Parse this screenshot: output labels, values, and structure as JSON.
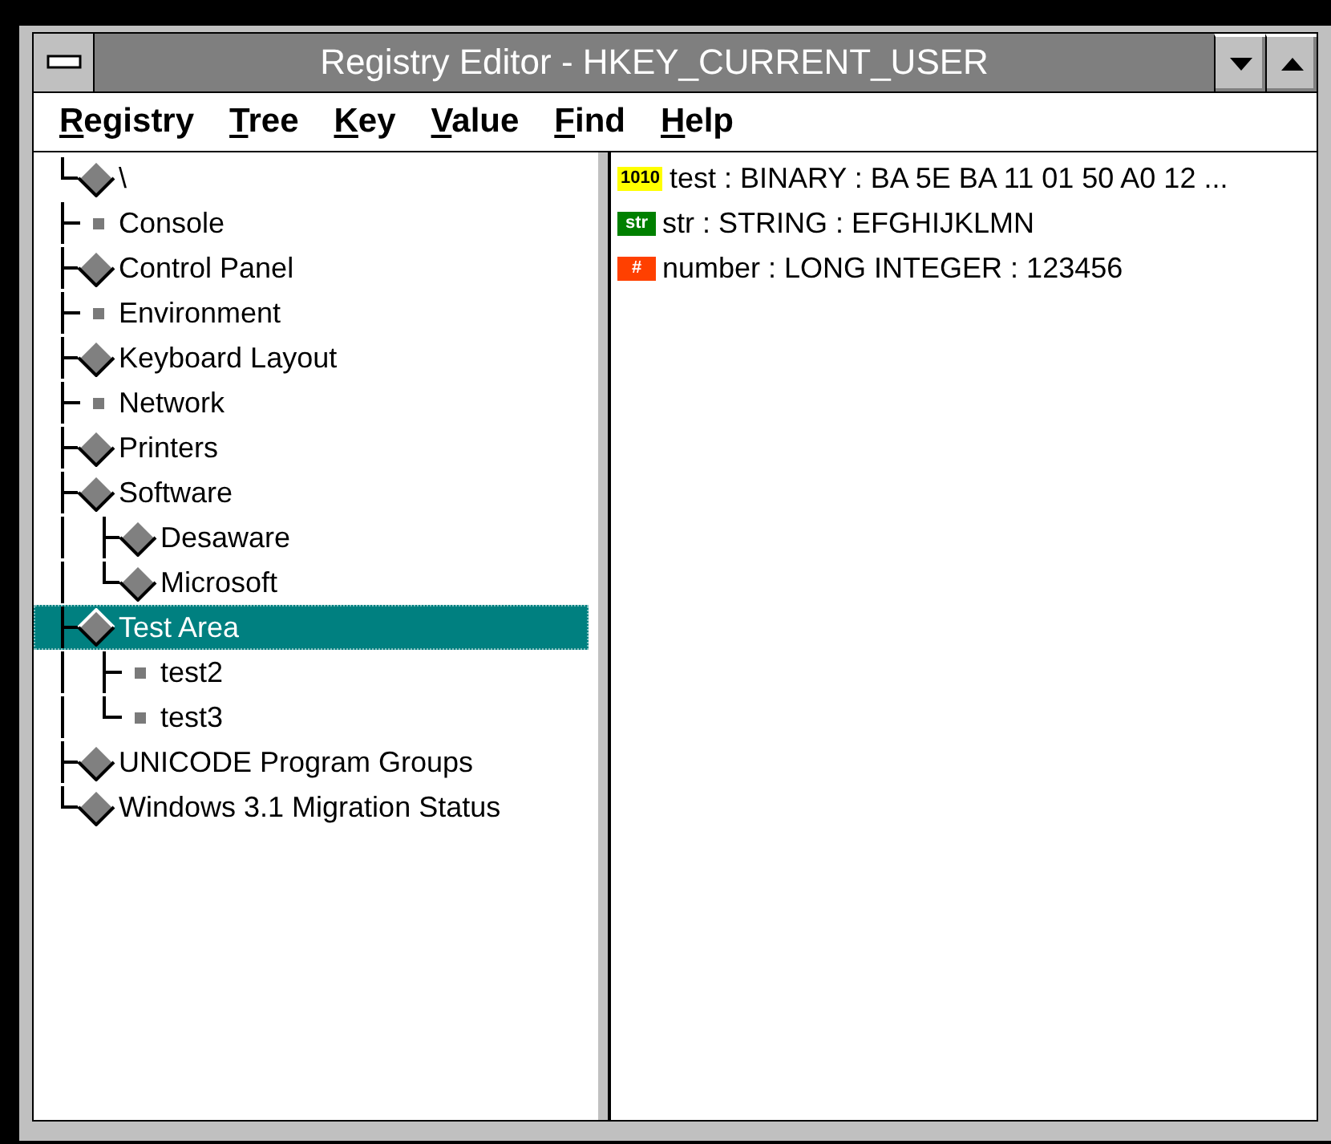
{
  "window": {
    "title": "Registry Editor - HKEY_CURRENT_USER"
  },
  "menu": [
    "Registry",
    "Tree",
    "Key",
    "Value",
    "Find",
    "Help"
  ],
  "tree": {
    "label": "\\",
    "kind": "folder",
    "selected": false,
    "children": [
      {
        "label": "Console",
        "kind": "leaf",
        "selected": false
      },
      {
        "label": "Control Panel",
        "kind": "folder",
        "selected": false
      },
      {
        "label": "Environment",
        "kind": "leaf",
        "selected": false
      },
      {
        "label": "Keyboard Layout",
        "kind": "folder",
        "selected": false
      },
      {
        "label": "Network",
        "kind": "leaf",
        "selected": false
      },
      {
        "label": "Printers",
        "kind": "folder",
        "selected": false
      },
      {
        "label": "Software",
        "kind": "folder",
        "selected": false,
        "children": [
          {
            "label": "Desaware",
            "kind": "folder",
            "selected": false
          },
          {
            "label": "Microsoft",
            "kind": "folder",
            "selected": false
          }
        ]
      },
      {
        "label": "Test Area",
        "kind": "folder",
        "selected": true,
        "children": [
          {
            "label": "test2",
            "kind": "leaf",
            "selected": false
          },
          {
            "label": "test3",
            "kind": "leaf",
            "selected": false
          }
        ]
      },
      {
        "label": "UNICODE Program Groups",
        "kind": "folder",
        "selected": false
      },
      {
        "label": "Windows 3.1 Migration Status",
        "kind": "folder",
        "selected": false
      }
    ]
  },
  "values": [
    {
      "kind": "binary",
      "badge": "1010",
      "text": "test : BINARY : BA 5E BA 11 01 50 A0 12 ..."
    },
    {
      "kind": "string",
      "badge": "str",
      "text": "str : STRING : EFGHIJKLMN"
    },
    {
      "kind": "long",
      "badge": "#",
      "text": "number : LONG INTEGER : 123456"
    }
  ]
}
